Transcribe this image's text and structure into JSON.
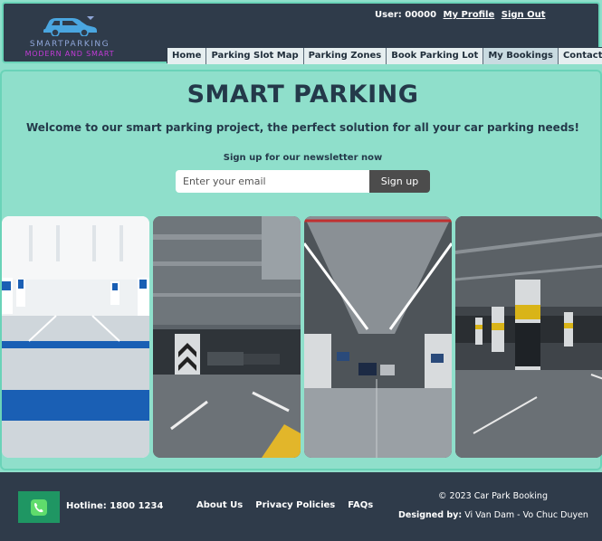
{
  "header": {
    "logo": {
      "line1": "SMARTPARKING",
      "line2": "MODERN AND SMART"
    },
    "user_label": "User: 00000",
    "my_profile": "My Profile",
    "sign_out": "Sign Out",
    "nav": [
      {
        "label": "Home"
      },
      {
        "label": "Parking Slot Map"
      },
      {
        "label": "Parking Zones"
      },
      {
        "label": "Book Parking Lot"
      },
      {
        "label": "My Bookings"
      },
      {
        "label": "Contact Us"
      }
    ]
  },
  "main": {
    "title": "SMART PARKING",
    "welcome": "Welcome to our smart parking project, the perfect solution for all your car parking needs!",
    "newsletter_label": "Sign up for our newsletter now",
    "email_placeholder": "Enter your email",
    "signup_label": "Sign up"
  },
  "footer": {
    "hotline": "Hotline: 1800 1234",
    "links": [
      {
        "label": "About Us"
      },
      {
        "label": "Privacy Policies"
      },
      {
        "label": "FAQs"
      }
    ],
    "copyright": "© 2023 Car Park Booking",
    "designed_by_label": "Designed by:",
    "designed_by_names": "Vi Van Dam - Vo Chuc Duyen"
  },
  "colors": {
    "header_bg": "#2f3b4a",
    "page_bg": "#8fdfcb",
    "title": "#24394a",
    "signup_button": "#4c4c4c",
    "hotline_icon_bg": "#1f9663"
  }
}
